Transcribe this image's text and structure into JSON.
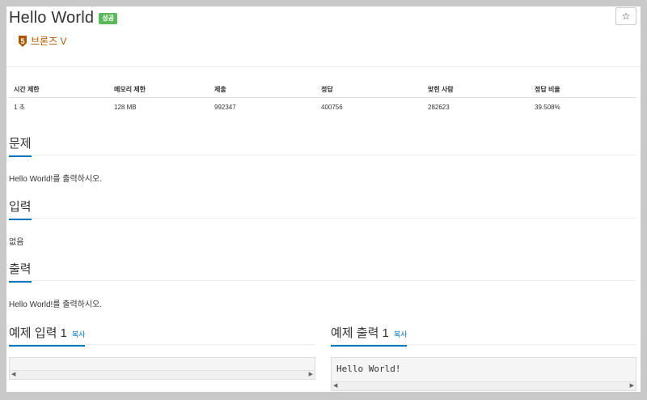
{
  "problem": {
    "title": "Hello World",
    "result_badge": "성공",
    "tier_label": "브론즈 V",
    "tier_number": "5",
    "tier_color": "#ad5600",
    "star_icon": "☆"
  },
  "info_table": {
    "headers": [
      "시간 제한",
      "메모리 제한",
      "제출",
      "정답",
      "맞힌 사람",
      "정답 비율"
    ],
    "values": [
      "1 초",
      "128 MB",
      "992347",
      "400756",
      "282623",
      "39.508%"
    ]
  },
  "sections": {
    "description": {
      "heading": "문제",
      "text": "Hello World!를 출력하시오."
    },
    "input": {
      "heading": "입력",
      "text": "없음"
    },
    "output": {
      "heading": "출력",
      "text": "Hello World!를 출력하시오."
    }
  },
  "samples": {
    "input": {
      "heading": "예제 입력 1",
      "copy_label": "복사",
      "content": ""
    },
    "output": {
      "heading": "예제 출력 1",
      "copy_label": "복사",
      "content": "Hello World!"
    }
  },
  "scroll_icons": {
    "left": "◀",
    "right": "▶"
  }
}
